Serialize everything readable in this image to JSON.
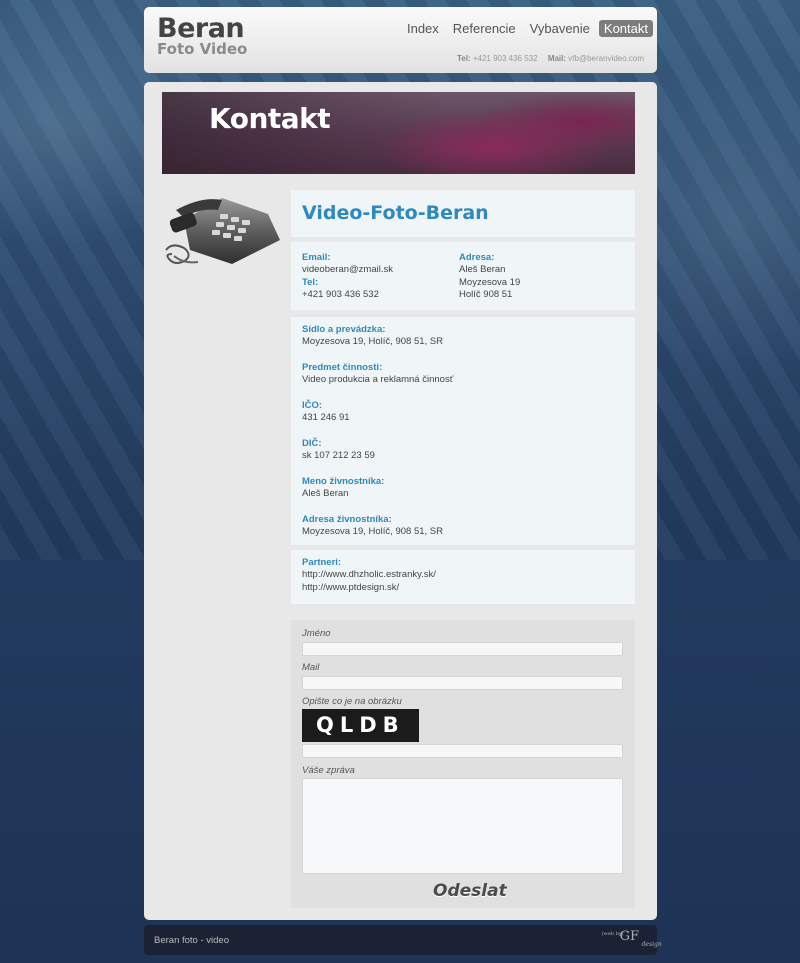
{
  "header": {
    "logo_main": "Beran",
    "logo_sub": "Foto Video",
    "nav": [
      "Index",
      "Referencie",
      "Vybavenie",
      "Kontakt"
    ],
    "active_nav": "Kontakt",
    "tel_label": "Tel:",
    "tel_value": "+421 903 436 532",
    "mail_label": "Mail:",
    "mail_value": "vfb@beranvideo.com"
  },
  "banner": {
    "title": "Kontakt"
  },
  "company": {
    "name": "Video-Foto-Beran"
  },
  "contact": {
    "email_label": "Email:",
    "email_value": "videoberan@zmail.sk",
    "tel_label": "Tel:",
    "tel_value": "+421 903 436 532",
    "address_label": "Adresa:",
    "address_lines": [
      "Aleš Beran",
      "Moyzesova 19",
      "Holíč 908 51"
    ]
  },
  "info": [
    {
      "label": "Sídlo a prevádzka:",
      "value": "Moyzesova 19, Holíč, 908 51, SR"
    },
    {
      "label": "Predmet činnosti:",
      "value": "Video produkcia a reklamná činnosť"
    },
    {
      "label": "IČO:",
      "value": "431 246 91"
    },
    {
      "label": "DIČ:",
      "value": "sk 107 212 23 59"
    },
    {
      "label": "Meno živnostníka:",
      "value": "Aleš Beran"
    },
    {
      "label": "Adresa živnostníka:",
      "value": "Moyzesova 19, Holíč, 908 51, SR"
    }
  ],
  "partners": {
    "label": "Partneri:",
    "links": [
      "http://www.dhzholic.estranky.sk/",
      "http://www.ptdesign.sk/"
    ]
  },
  "form": {
    "name_label": "Jméno",
    "mail_label": "Mail",
    "captcha_label": "Opište co je na obrázku",
    "captcha_text": "QLDB",
    "message_label": "Váše zpráva",
    "submit_label": "Odeslat"
  },
  "footer": {
    "text": "Beran foto - video",
    "logo_small": "(web by)",
    "logo_main": "GF",
    "logo_script": "design"
  }
}
